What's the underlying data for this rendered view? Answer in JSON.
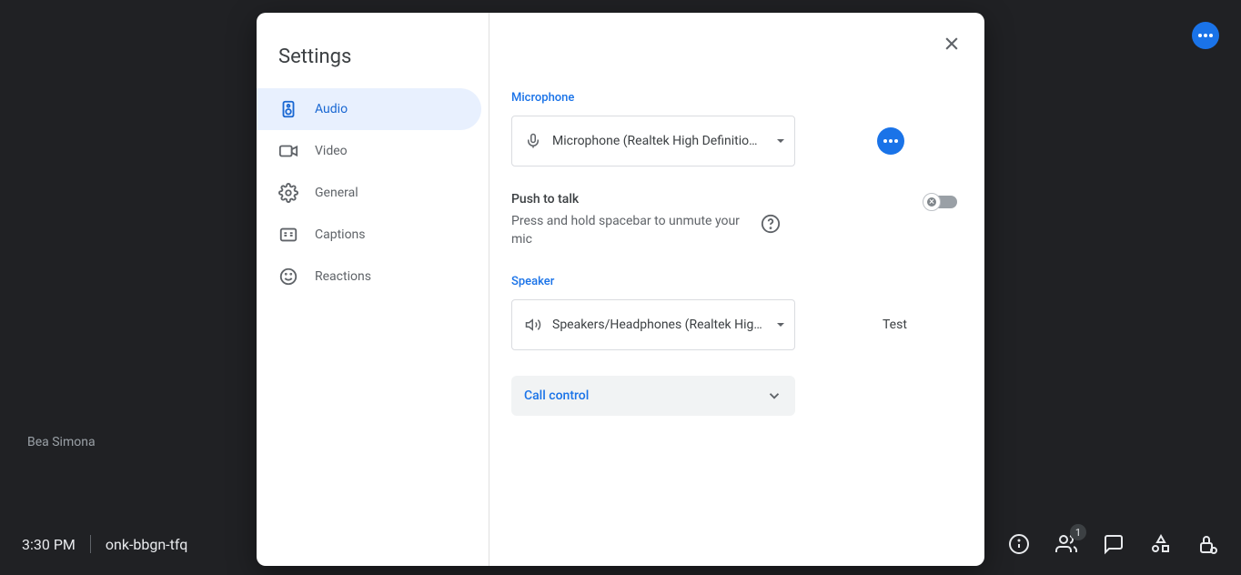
{
  "background": {
    "participant_name": "Bea Simona",
    "time": "3:30 PM",
    "meeting_code": "onk-bbgn-tfq",
    "people_badge": "1"
  },
  "modal": {
    "title": "Settings",
    "nav": {
      "audio": "Audio",
      "video": "Video",
      "general": "General",
      "captions": "Captions",
      "reactions": "Reactions"
    },
    "audio": {
      "mic_label": "Microphone",
      "mic_value": "Microphone (Realtek High Definitio…",
      "ptt_title": "Push to talk",
      "ptt_desc": "Press and hold spacebar to unmute your mic",
      "speaker_label": "Speaker",
      "speaker_value": "Speakers/Headphones (Realtek Hig…",
      "test_label": "Test",
      "call_control_label": "Call control"
    }
  }
}
